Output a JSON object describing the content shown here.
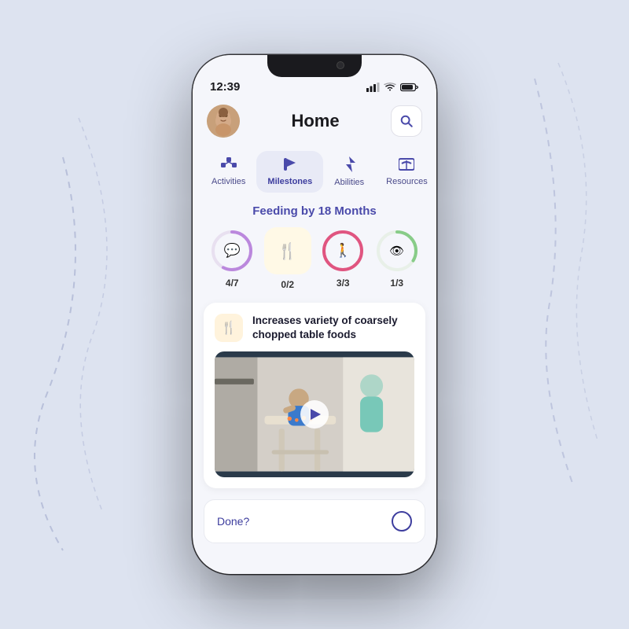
{
  "background": "#dde3f0",
  "statusBar": {
    "time": "12:39",
    "signal": "▪▪▪",
    "wifi": "wifi",
    "battery": "battery"
  },
  "header": {
    "title": "Home",
    "searchLabel": "search"
  },
  "navTabs": [
    {
      "id": "activities",
      "label": "Activities",
      "icon": "🧩",
      "active": false
    },
    {
      "id": "milestones",
      "label": "Milestones",
      "icon": "🚩",
      "active": true
    },
    {
      "id": "abilities",
      "label": "Abilities",
      "icon": "⚡",
      "active": false
    },
    {
      "id": "resources",
      "label": "Resources",
      "icon": "📖",
      "active": false
    }
  ],
  "sectionTitle": "Feeding by 18 Months",
  "progressItems": [
    {
      "id": "chat",
      "icon": "💬",
      "iconColor": "#8866cc",
      "value": "4/7",
      "type": "circle",
      "color": "#cc88cc",
      "percent": 57
    },
    {
      "id": "fork",
      "icon": "🍴",
      "iconColor": "#cc9922",
      "value": "0/2",
      "type": "square",
      "color": "#f5d580",
      "percent": 0
    },
    {
      "id": "walk",
      "icon": "🚶",
      "iconColor": "#e05580",
      "value": "3/3",
      "type": "circle",
      "color": "#e05580",
      "percent": 100
    },
    {
      "id": "eye",
      "icon": "👁",
      "iconColor": "#66aa66",
      "value": "1/3",
      "type": "circle",
      "color": "#88cc88",
      "percent": 33
    }
  ],
  "activityCard": {
    "icon": "🍴",
    "title": "Increases variety of coarsely chopped table foods",
    "hasVideo": true
  },
  "doneRow": {
    "label": "Done?",
    "checked": false
  }
}
